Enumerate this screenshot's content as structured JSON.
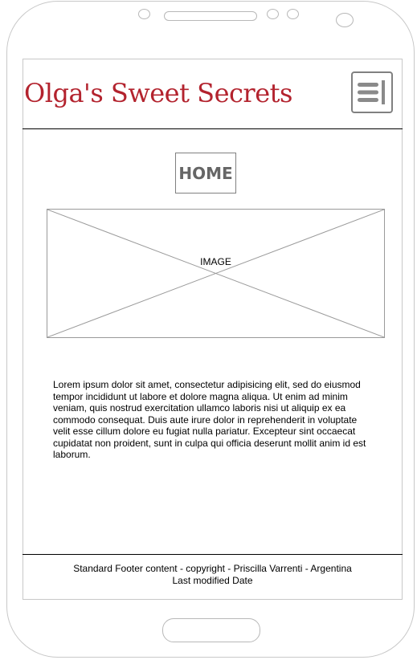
{
  "header": {
    "site_title": "Olga's Sweet Secrets",
    "menu_icon": "hamburger-menu-icon",
    "title_color": "#b3232e"
  },
  "nav": {
    "home_label": "HOME"
  },
  "hero": {
    "image_label": "IMAGE"
  },
  "content": {
    "body_text": "Lorem ipsum dolor sit amet, consectetur adipisicing elit, sed do eiusmod tempor incididunt ut labore et dolore magna aliqua. Ut enim ad minim veniam, quis nostrud exercitation ullamco laboris nisi ut aliquip ex ea commodo consequat. Duis aute irure dolor in reprehenderit in voluptate velit esse cillum dolore eu fugiat nulla pariatur. Excepteur sint occaecat cupidatat non proident, sunt in culpa qui officia deserunt mollit anim id est laborum."
  },
  "footer": {
    "line1": "Standard Footer content - copyright - Priscilla Varrenti - Argentina",
    "line2": "Last modified Date"
  }
}
